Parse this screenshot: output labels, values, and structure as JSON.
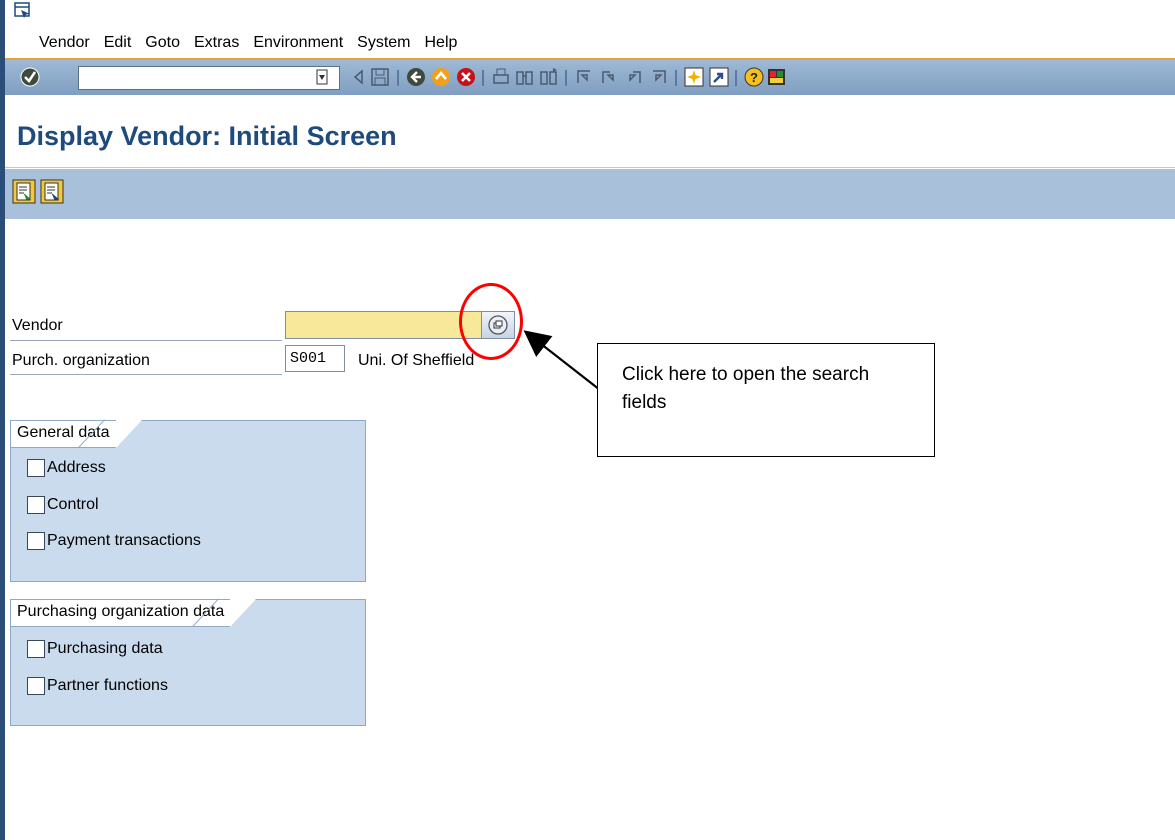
{
  "menubar": {
    "items": [
      {
        "label": "Vendor"
      },
      {
        "label": "Edit"
      },
      {
        "label": "Goto"
      },
      {
        "label": "Extras"
      },
      {
        "label": "Environment"
      },
      {
        "label": "System"
      },
      {
        "label": "Help"
      }
    ]
  },
  "toolbar": {
    "command_field_value": "",
    "icons": [
      "enter-icon",
      "back-triangle-icon",
      "save-icon",
      "back-icon",
      "exit-icon",
      "cancel-icon",
      "print-icon",
      "find-icon",
      "find-next-icon",
      "first-page-icon",
      "previous-page-icon",
      "next-page-icon",
      "last-page-icon",
      "create-session-icon",
      "shortcut-icon",
      "help-icon",
      "customize-layout-icon"
    ]
  },
  "header": {
    "title": "Display Vendor: Initial Screen"
  },
  "form": {
    "vendor_label": "Vendor",
    "vendor_value": "",
    "purch_org_label": "Purch. organization",
    "purch_org_value": "S001",
    "purch_org_desc": "Uni. Of Sheffield"
  },
  "groups": [
    {
      "title": "General data",
      "options": [
        {
          "label": "Address",
          "checked": false
        },
        {
          "label": "Control",
          "checked": false
        },
        {
          "label": "Payment transactions",
          "checked": false
        }
      ]
    },
    {
      "title": "Purchasing organization data",
      "options": [
        {
          "label": "Purchasing data",
          "checked": false
        },
        {
          "label": "Partner functions",
          "checked": false
        }
      ]
    }
  ],
  "annotation": {
    "callout_text": "Click here to open the search fields",
    "highlight_color": "#ff0000"
  },
  "colors": {
    "title": "#1f4a7c",
    "toolbar": "#8faacc",
    "required_field": "#f8e99a",
    "group_bg": "#c9dbed"
  }
}
